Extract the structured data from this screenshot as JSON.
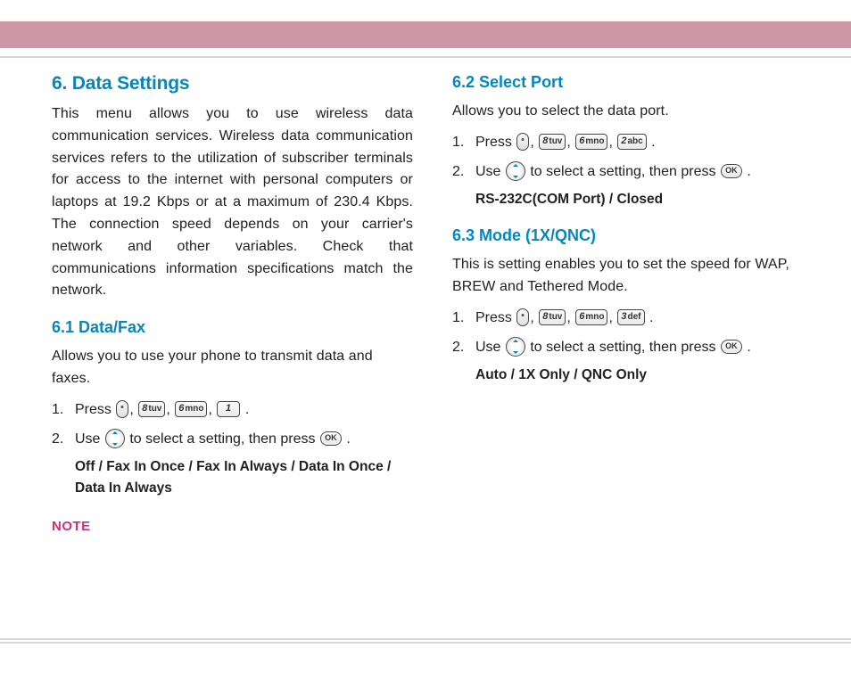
{
  "left": {
    "h1": "6. Data Settings",
    "intro": "This menu allows you to use wireless data communication services. Wireless data communication services refers to the utilization of subscriber terminals for access to the internet with personal computers or laptops at 19.2 Kbps or at a maximum of 230.4 Kbps. The connection speed depends on your carrier's network and other variables. Check that communications information specifications match the network.",
    "s61_h": "6.1 Data/Fax",
    "s61_p": "Allows you to use your phone to transmit data and faxes.",
    "s61_1a": "Press ",
    "s61_2a": "Use ",
    "s61_2b": " to select a setting, then press ",
    "s61_opts": "Off / Fax In Once / Fax In Always / Data In Once / Data In Always",
    "note": "NOTE"
  },
  "right": {
    "s62_h": "6.2 Select Port",
    "s62_p": "Allows you to select the data port.",
    "s62_1a": "Press ",
    "s62_2a": "Use ",
    "s62_2b": " to select a setting, then press ",
    "s62_opts": "RS-232C(COM Port) / Closed",
    "s63_h": "6.3 Mode (1X/QNC)",
    "s63_p": "This is setting enables you to set the speed for WAP, BREW and Tethered Mode.",
    "s63_1a": "Press ",
    "s63_2a": "Use ",
    "s63_2b": " to select a setting, then press ",
    "s63_opts": "Auto / 1X Only / QNC Only"
  },
  "keys": {
    "k8": {
      "d": "8",
      "s": "tuv"
    },
    "k6": {
      "d": "6",
      "s": "mno"
    },
    "k1": {
      "d": "1",
      "s": ""
    },
    "k2": {
      "d": "2",
      "s": "abc"
    },
    "k3": {
      "d": "3",
      "s": "def"
    },
    "ok": "OK"
  },
  "glue": {
    "comma": ", ",
    "period": " .",
    "n1": "1.",
    "n2": "2."
  }
}
